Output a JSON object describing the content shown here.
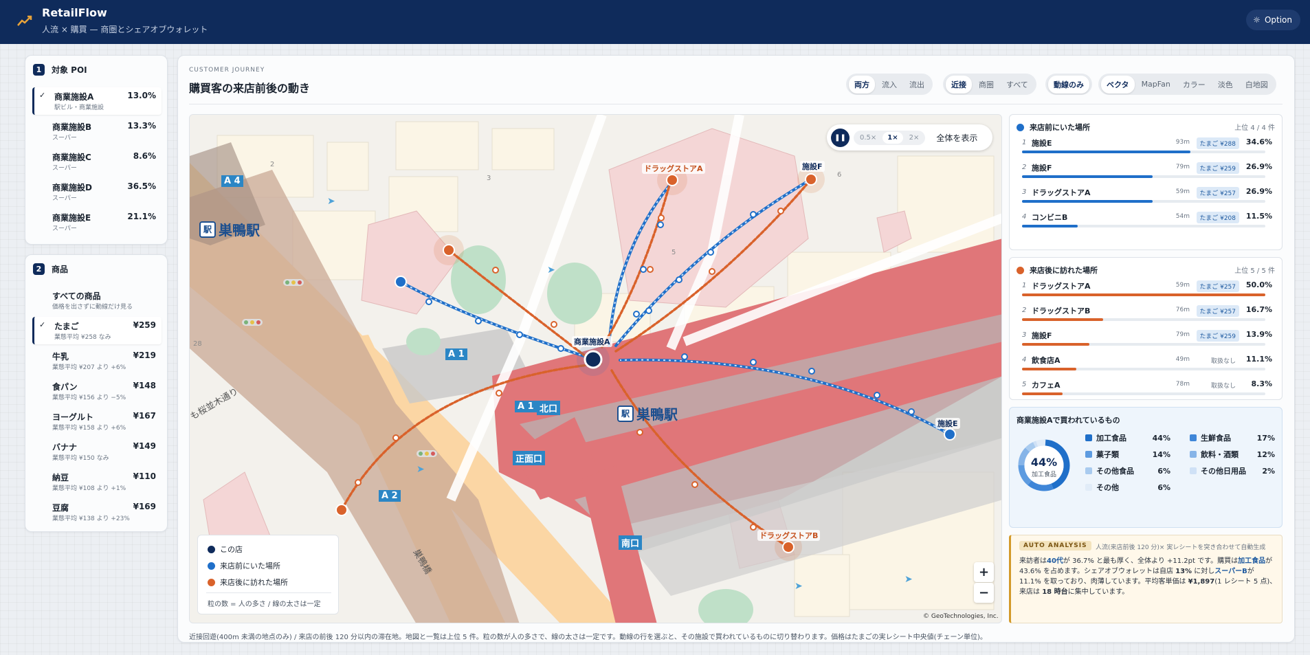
{
  "header": {
    "brand": "RetailFlow",
    "subtitle": "人流 × 購買 — 商圏とシェアオブウォレット",
    "option_label": "Option"
  },
  "poi_panel": {
    "number": "1",
    "title": "対象 POI",
    "items": [
      {
        "name": "商業施設A",
        "type": "駅ビル・商業施設",
        "pct": "13.0%",
        "selected": true
      },
      {
        "name": "商業施設B",
        "type": "スーパー",
        "pct": "13.3%"
      },
      {
        "name": "商業施設C",
        "type": "スーパー",
        "pct": "8.6%"
      },
      {
        "name": "商業施設D",
        "type": "スーパー",
        "pct": "36.5%"
      },
      {
        "name": "商業施設E",
        "type": "スーパー",
        "pct": "21.1%"
      }
    ]
  },
  "product_panel": {
    "number": "2",
    "title": "商品",
    "items": [
      {
        "name": "すべての商品",
        "note": "価格を出さずに動線だけ見る",
        "price": ""
      },
      {
        "name": "たまご",
        "note": "業態平均 ¥258 なみ",
        "price": "¥259",
        "selected": true
      },
      {
        "name": "牛乳",
        "note": "業態平均 ¥207 より +6%",
        "price": "¥219"
      },
      {
        "name": "食パン",
        "note": "業態平均 ¥156 より −5%",
        "price": "¥148"
      },
      {
        "name": "ヨーグルト",
        "note": "業態平均 ¥158 より +6%",
        "price": "¥167"
      },
      {
        "name": "バナナ",
        "note": "業態平均 ¥150 なみ",
        "price": "¥149"
      },
      {
        "name": "納豆",
        "note": "業態平均 ¥108 より +1%",
        "price": "¥110"
      },
      {
        "name": "豆腐",
        "note": "業態平均 ¥138 より +23%",
        "price": "¥169"
      }
    ]
  },
  "main": {
    "eyebrow": "CUSTOMER JOURNEY",
    "title": "購買客の来店前後の動き",
    "seg_direction": [
      "両方",
      "流入",
      "流出"
    ],
    "seg_range": [
      "近接",
      "商圏",
      "すべて"
    ],
    "seg_lines": [
      "動線のみ"
    ],
    "seg_style": [
      "ベクタ",
      "MapFan",
      "カラー",
      "淡色",
      "白地図"
    ]
  },
  "map": {
    "play_icon": "pause-icon",
    "speeds": [
      "0.5×",
      "1×",
      "2×"
    ],
    "fit_label": "全体を表示",
    "center_label": "商業施設A",
    "places": {
      "f": "施設F",
      "da": "ドラッグストアA",
      "e": "施設E",
      "db": "ドラッグストアB"
    },
    "stations": [
      "巣鴨駅",
      "巣鴨駅"
    ],
    "exits": [
      "A 4",
      "A 1",
      "A 1",
      "北口",
      "正面口",
      "A 2",
      "南口"
    ],
    "streets": [
      "も桜並木通り",
      "巣鴨橋"
    ],
    "block_numbers": [
      "2",
      "3",
      "28",
      "5",
      "6"
    ],
    "legend": {
      "here": "この店",
      "before": "来店前にいた場所",
      "after": "来店後に訪れた場所",
      "note": "粒の数 = 人の多さ / 線の太さは一定"
    },
    "zoom_in": "+",
    "zoom_out": "−",
    "attribution": "© GeoTechnologies, Inc."
  },
  "colors": {
    "navy": "#0f2b5b",
    "blue": "#1f6fc9",
    "orange": "#d9622b"
  },
  "before_panel": {
    "title": "来店前にいた場所",
    "top": "上位 4 / 4 件",
    "rows": [
      {
        "rank": "1",
        "name": "施設E",
        "dist": "93m",
        "price": "たまご ¥288",
        "pct": "34.6%",
        "share": 0.346
      },
      {
        "rank": "2",
        "name": "施設F",
        "dist": "79m",
        "price": "たまご ¥259",
        "pct": "26.9%",
        "share": 0.269
      },
      {
        "rank": "3",
        "name": "ドラッグストアA",
        "dist": "59m",
        "price": "たまご ¥257",
        "pct": "26.9%",
        "share": 0.269
      },
      {
        "rank": "4",
        "name": "コンビニB",
        "dist": "54m",
        "price": "たまご ¥208",
        "pct": "11.5%",
        "share": 0.115
      }
    ]
  },
  "after_panel": {
    "title": "来店後に訪れた場所",
    "top": "上位 5 / 5 件",
    "rows": [
      {
        "rank": "1",
        "name": "ドラッグストアA",
        "dist": "59m",
        "price": "たまご ¥257",
        "pct": "50.0%",
        "share": 0.5
      },
      {
        "rank": "2",
        "name": "ドラッグストアB",
        "dist": "76m",
        "price": "たまご ¥257",
        "pct": "16.7%",
        "share": 0.167
      },
      {
        "rank": "3",
        "name": "施設F",
        "dist": "79m",
        "price": "たまご ¥259",
        "pct": "13.9%",
        "share": 0.139
      },
      {
        "rank": "4",
        "name": "飲食店A",
        "dist": "49m",
        "price": "取扱なし",
        "pct": "11.1%",
        "share": 0.111
      },
      {
        "rank": "5",
        "name": "カフェA",
        "dist": "78m",
        "price": "取扱なし",
        "pct": "8.3%",
        "share": 0.083
      }
    ]
  },
  "basket": {
    "title": "商業施設Aで買われているもの",
    "donut_value": "44%",
    "donut_label": "加工食品",
    "cats": [
      {
        "name": "加工食品",
        "pct": "44%",
        "color": "#1f6fc9",
        "share": 0.44
      },
      {
        "name": "生鮮食品",
        "pct": "17%",
        "color": "#3f86d8",
        "share": 0.17
      },
      {
        "name": "菓子類",
        "pct": "14%",
        "color": "#5d9be0",
        "share": 0.14
      },
      {
        "name": "飲料・酒類",
        "pct": "12%",
        "color": "#86b4e8",
        "share": 0.12
      },
      {
        "name": "その他食品",
        "pct": "6%",
        "color": "#a9cbef",
        "share": 0.06
      },
      {
        "name": "その他日用品",
        "pct": "2%",
        "color": "#cfe1f6",
        "share": 0.02
      },
      {
        "name": "その他",
        "pct": "6%",
        "color": "#e1ecf8",
        "share": 0.06
      }
    ]
  },
  "analysis": {
    "badge": "AUTO ANALYSIS",
    "caption": "人流(来店前後 120 分)× 実レシートを突き合わせて自動生成",
    "t1": "来訪者は",
    "h1": "40代",
    "t2": "が 36.7% と最も厚く、全体より +11.2pt です。購買は",
    "h2": "加工食品",
    "t3": "が 43.6% を占めます。シェアオブウォレットは自店 ",
    "h3": "13%",
    "t4": " に対し",
    "h4": "スーパーB",
    "t5": "が 11.1% を取っており、肉薄しています。平均客単価は ",
    "h5": "¥1,897",
    "t6": "(1 レシート 5 点)、来店は ",
    "h6": "18 時台",
    "t7": "に集中しています。"
  },
  "footer": "近接回遊(400m 未満の地点のみ) / 来店の前後 120 分以内の滞在地。地図と一覧は上位 5 件。粒の数が人の多さで、線の太さは一定です。動線の行を選ぶと、その施設で買われているものに切り替わります。価格はたまごの実レシート中央値(チェーン単位)。"
}
